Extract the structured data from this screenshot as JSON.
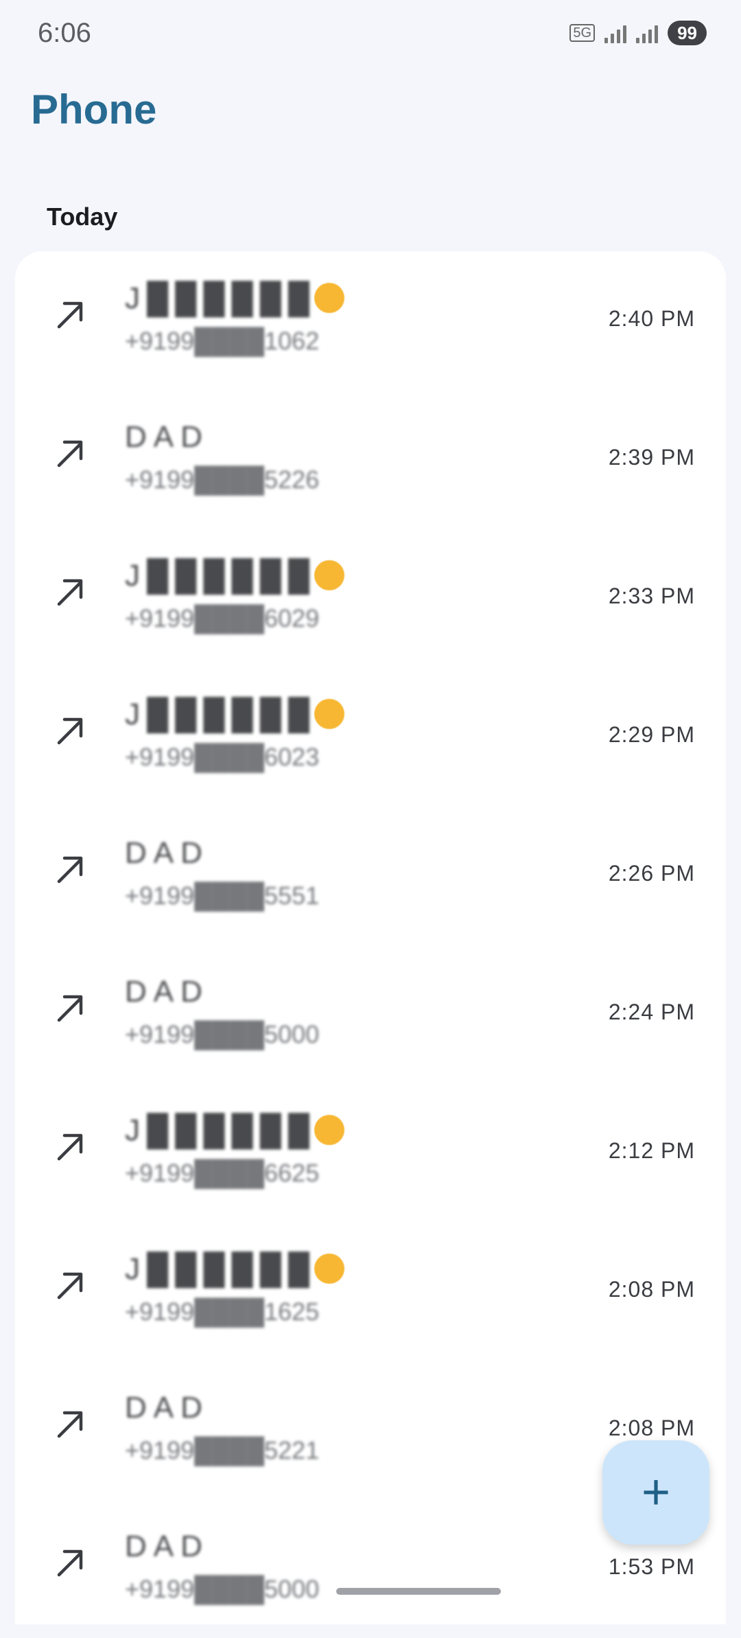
{
  "status_bar": {
    "time": "6:06",
    "network": "5G",
    "battery": "99"
  },
  "app": {
    "title": "Phone"
  },
  "section": {
    "label": "Today"
  },
  "calls": [
    {
      "name": "J██████",
      "number": "+9199████1062",
      "time": "2:40 PM",
      "type": "outgoing-call-icon",
      "emoji": true
    },
    {
      "name": "DAD",
      "number": "+9199████5226",
      "time": "2:39 PM",
      "type": "outgoing-call-icon",
      "emoji": false
    },
    {
      "name": "J██████",
      "number": "+9199████6029",
      "time": "2:33 PM",
      "type": "outgoing-call-icon",
      "emoji": true
    },
    {
      "name": "J██████",
      "number": "+9199████6023",
      "time": "2:29 PM",
      "type": "outgoing-call-icon",
      "emoji": true
    },
    {
      "name": "DAD",
      "number": "+9199████5551",
      "time": "2:26 PM",
      "type": "outgoing-call-icon",
      "emoji": false
    },
    {
      "name": "DAD",
      "number": "+9199████5000",
      "time": "2:24 PM",
      "type": "outgoing-call-icon",
      "emoji": false
    },
    {
      "name": "J██████",
      "number": "+9199████6625",
      "time": "2:12 PM",
      "type": "outgoing-call-icon",
      "emoji": true
    },
    {
      "name": "J██████",
      "number": "+9199████1625",
      "time": "2:08 PM",
      "type": "outgoing-call-icon",
      "emoji": true
    },
    {
      "name": "DAD",
      "number": "+9199████5221",
      "time": "2:08 PM",
      "type": "outgoing-call-icon",
      "emoji": false
    },
    {
      "name": "DAD",
      "number": "+9199████5000",
      "time": "1:53 PM",
      "type": "outgoing-call-icon",
      "emoji": false
    }
  ],
  "fab": {
    "icon": "plus-icon",
    "glyph": "+"
  },
  "colors": {
    "accent": "#286B92",
    "background": "#F5F6FC",
    "card": "#FFFFFF",
    "fab": "#CDE5FB"
  }
}
